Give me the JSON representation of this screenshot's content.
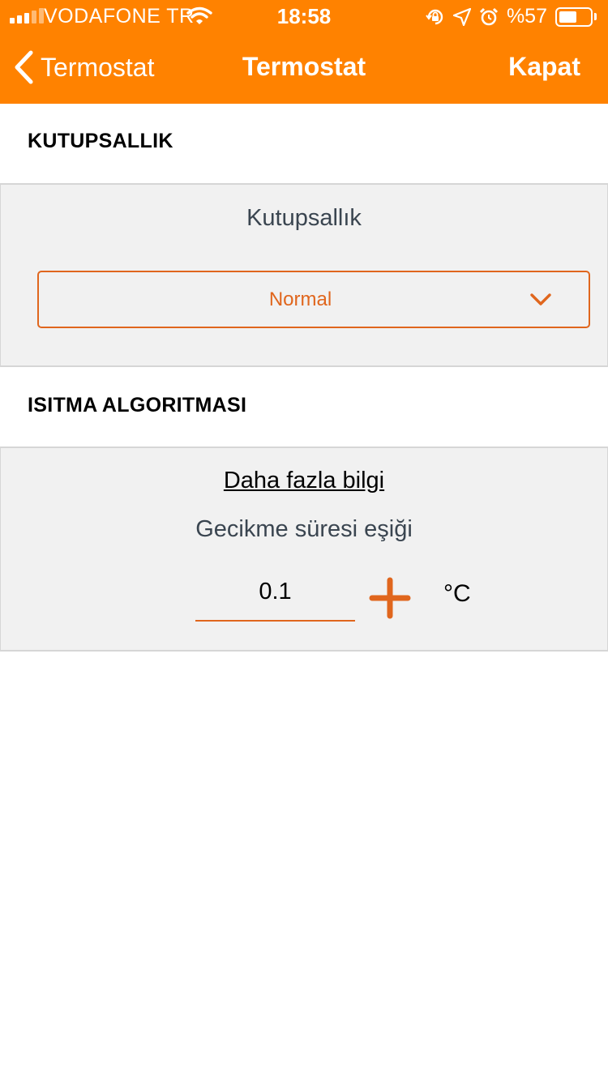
{
  "status_bar": {
    "carrier": "VODAFONE TR",
    "time": "18:58",
    "battery": "%57",
    "battery_level": 0.57
  },
  "nav": {
    "back_label": "Termostat",
    "title": "Termostat",
    "close_label": "Kapat"
  },
  "polarity": {
    "section_title": "KUTUPSALLIK",
    "label": "Kutupsallık",
    "selected": "Normal"
  },
  "heating": {
    "section_title": "ISITMA ALGORITMASI",
    "more_info": "Daha fazla bilgi",
    "delay_label": "Gecikme süresi eşiği",
    "value": "0.1",
    "unit": "°C"
  },
  "colors": {
    "accent": "#ff8200",
    "field_accent": "#e0661d",
    "panel_bg": "#f1f1f1"
  }
}
